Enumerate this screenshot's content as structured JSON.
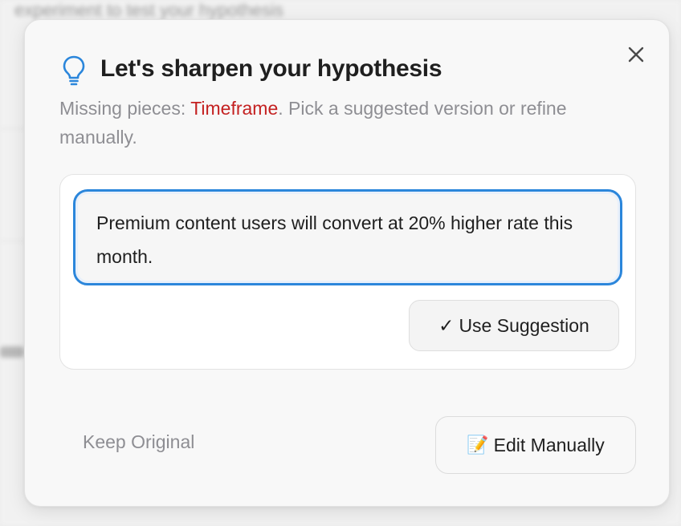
{
  "background": {
    "text": "experiment to test your hypothesis"
  },
  "dialog": {
    "title": "Let's sharpen your hypothesis",
    "subtitle_prefix": "Missing pieces: ",
    "missing_item": "Timeframe",
    "subtitle_suffix": ". Pick a suggested version or refine manually.",
    "suggestion_text": "Premium content users will convert at 20% higher rate this month.",
    "use_suggestion_check": "✓",
    "use_suggestion_label": "Use Suggestion",
    "keep_original_label": "Keep Original",
    "edit_manually_emoji": "📝",
    "edit_manually_label": "Edit Manually",
    "icons": {
      "title": "lightbulb-icon",
      "close": "close-icon",
      "edit": "memo-icon"
    },
    "colors": {
      "accent": "#2b86db",
      "missing": "#c42121",
      "muted": "#8e8e93"
    }
  }
}
